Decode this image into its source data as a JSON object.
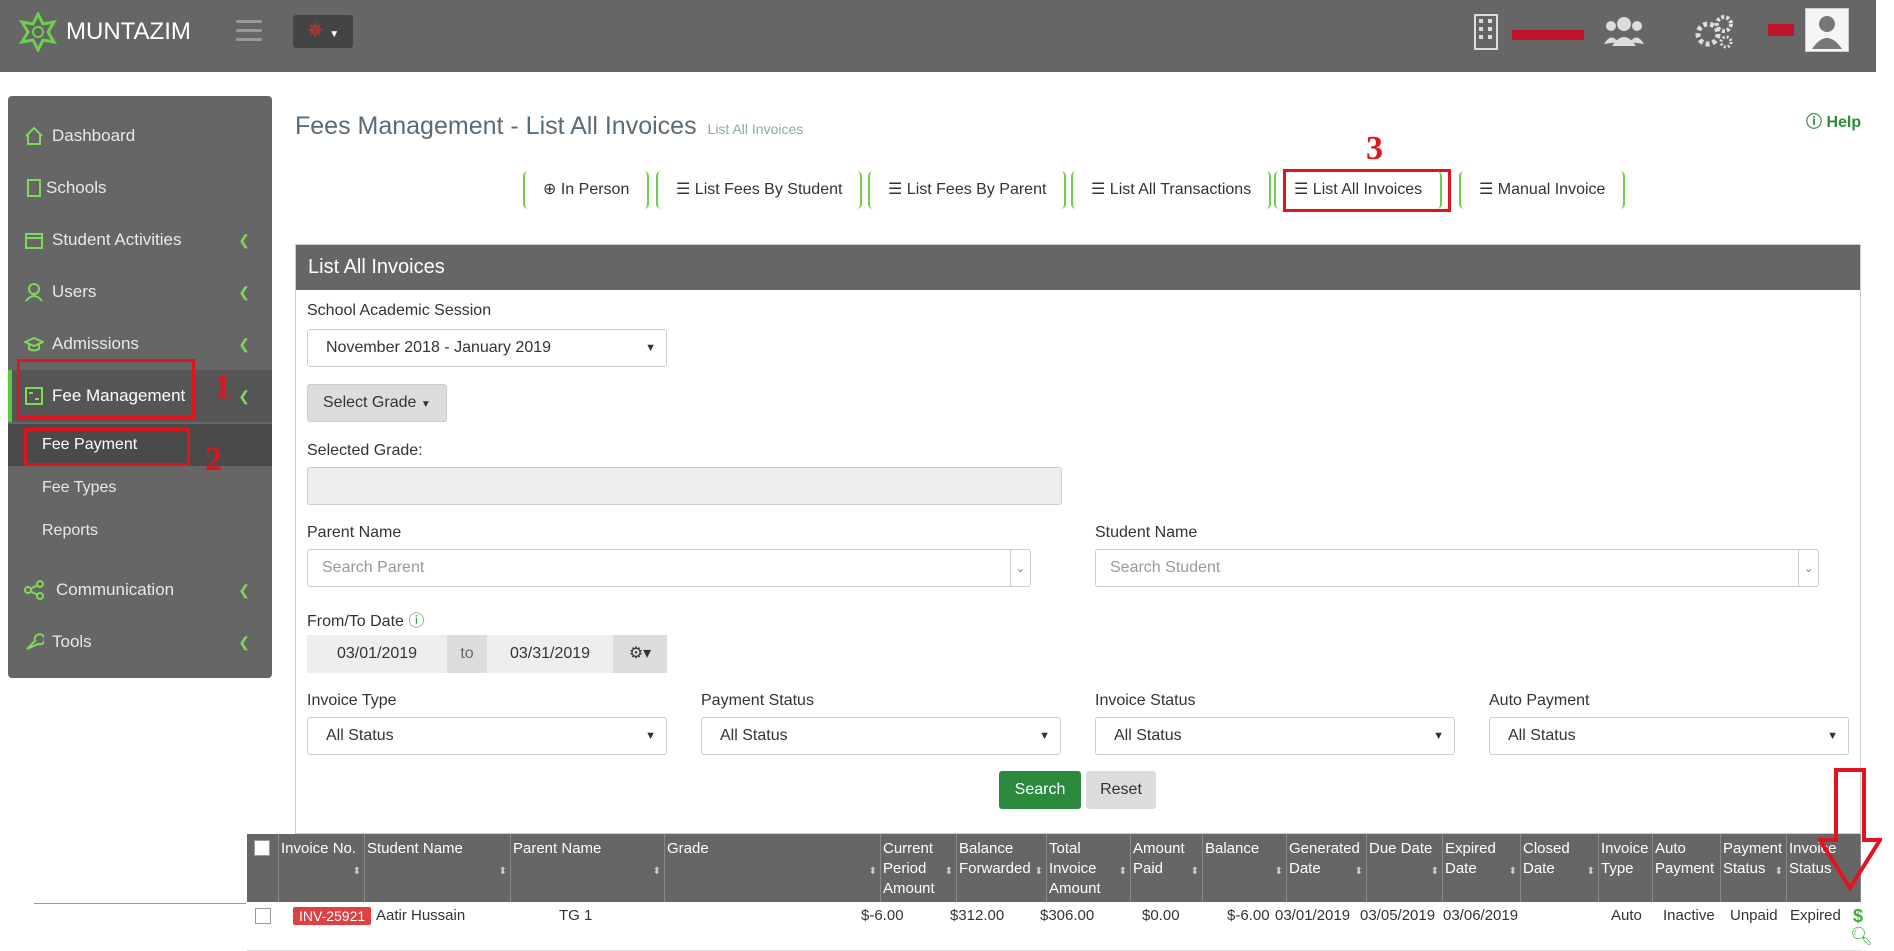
{
  "app": {
    "name": "MUNTAZIM"
  },
  "colors": {
    "accent": "#5cc83b",
    "annotation": "#e1141e",
    "topbar": "#666666",
    "primary_button": "#2b8a3e",
    "badge": "#e04040"
  },
  "sidebar": {
    "items": [
      {
        "label": "Dashboard",
        "icon": "home-icon"
      },
      {
        "label": "Schools",
        "icon": "building-icon"
      },
      {
        "label": "Student Activities",
        "icon": "calendar-icon"
      },
      {
        "label": "Users",
        "icon": "user-icon"
      },
      {
        "label": "Admissions",
        "icon": "graduation-cap-icon"
      },
      {
        "label": "Fee Management",
        "icon": "calculator-icon"
      },
      {
        "label": "Communication",
        "icon": "share-icon"
      },
      {
        "label": "Tools",
        "icon": "wrench-icon"
      }
    ],
    "subitems": [
      "Fee Payment",
      "Fee Types",
      "Reports"
    ]
  },
  "annotations": [
    "1",
    "2",
    "3"
  ],
  "page": {
    "title": "Fees Management - List All Invoices",
    "subtitle": "List All Invoices",
    "help": "Help"
  },
  "tabs": [
    "In Person",
    "List Fees By Student",
    "List Fees By Parent",
    "List All Transactions",
    "List All Invoices",
    "Manual Invoice"
  ],
  "panel": {
    "title": "List All Invoices",
    "session_label": "School Academic Session",
    "session_value": "November 2018 - January 2019",
    "grade_button": "Select Grade",
    "selected_grade_label": "Selected Grade:",
    "parent_label": "Parent Name",
    "parent_placeholder": "Search Parent",
    "student_label": "Student Name",
    "student_placeholder": "Search Student",
    "date_label": "From/To Date",
    "date_from": "03/01/2019",
    "date_to_word": "to",
    "date_to": "03/31/2019",
    "invoice_type_label": "Invoice Type",
    "invoice_type_value": "All Status",
    "payment_status_label": "Payment Status",
    "payment_status_value": "All Status",
    "invoice_status_label": "Invoice Status",
    "invoice_status_value": "All Status",
    "auto_payment_label": "Auto Payment",
    "auto_payment_value": "All Status",
    "search_button": "Search",
    "reset_button": "Reset"
  },
  "table": {
    "headers": [
      "Invoice No.",
      "Student Name",
      "Parent Name",
      "Grade",
      "Current Period Amount",
      "Balance Forwarded",
      "Total Invoice Amount",
      "Amount Paid",
      "Balance",
      "Generated Date",
      "Due Date",
      "Expired Date",
      "Closed Date",
      "Invoice Type",
      "Auto Payment",
      "Payment Status",
      "Invoice Status"
    ],
    "row": {
      "invoice_no": "INV-25921",
      "student": "Aatir Hussain",
      "grade": "TG 1",
      "current": "$-6.00",
      "forwarded": "$312.00",
      "total": "$306.00",
      "paid": "$0.00",
      "balance": "$-6.00",
      "generated": "03/01/2019",
      "due": "03/05/2019",
      "expired": "03/06/2019",
      "type": "Auto",
      "auto": "Inactive",
      "payment": "Unpaid",
      "status": "Expired",
      "action_symbol": "$"
    }
  }
}
